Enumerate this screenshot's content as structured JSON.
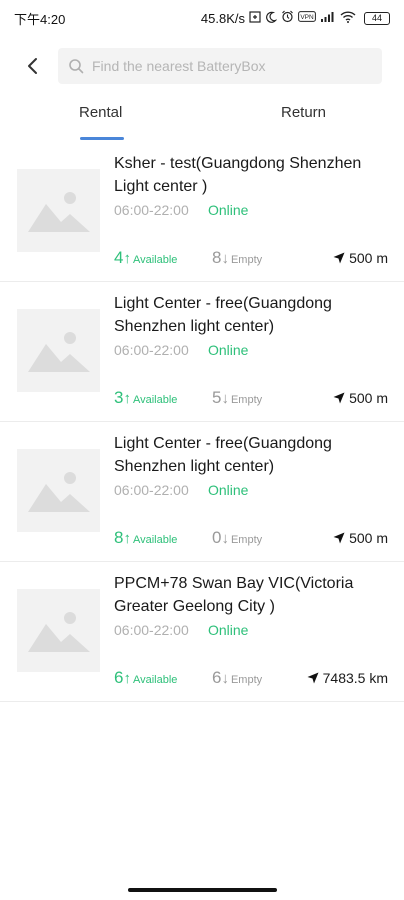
{
  "status_bar": {
    "time": "下午4:20",
    "network_speed": "45.8K/s",
    "icons": [
      "data-saver-icon",
      "moon-icon",
      "alarm-icon",
      "vpn-icon",
      "signal-icon",
      "wifi-icon"
    ],
    "vpn": "VPN",
    "battery": "44"
  },
  "header": {
    "back_icon": "chevron-left-icon",
    "search_icon": "search-icon",
    "search_placeholder": "Find the nearest BatteryBox"
  },
  "tabs": [
    {
      "label": "Rental",
      "active": true
    },
    {
      "label": "Return",
      "active": false
    }
  ],
  "colors": {
    "accent": "#4a86d9",
    "online": "#2ec07a",
    "muted": "#b0b0b0",
    "empty": "#9a9a9a"
  },
  "stations": [
    {
      "title": "Ksher - test(Guangdong Shenzhen Light center )",
      "hours": "06:00-22:00",
      "status": "Online",
      "available_count": "4",
      "available_label": "Available",
      "empty_count": "8",
      "empty_label": "Empty",
      "distance": "500 m"
    },
    {
      "title": "Light Center - free(Guangdong Shenzhen  light center)",
      "hours": "06:00-22:00",
      "status": "Online",
      "available_count": "3",
      "available_label": "Available",
      "empty_count": "5",
      "empty_label": "Empty",
      "distance": "500 m"
    },
    {
      "title": "Light Center - free(Guangdong Shenzhen  light center)",
      "hours": "06:00-22:00",
      "status": "Online",
      "available_count": "8",
      "available_label": "Available",
      "empty_count": "0",
      "empty_label": "Empty",
      "distance": "500 m"
    },
    {
      "title": "PPCM+78 Swan Bay VIC(Victoria Greater Geelong City  )",
      "hours": "06:00-22:00",
      "status": "Online",
      "available_count": "6",
      "available_label": "Available",
      "empty_count": "6",
      "empty_label": "Empty",
      "distance": "7483.5 km"
    }
  ]
}
